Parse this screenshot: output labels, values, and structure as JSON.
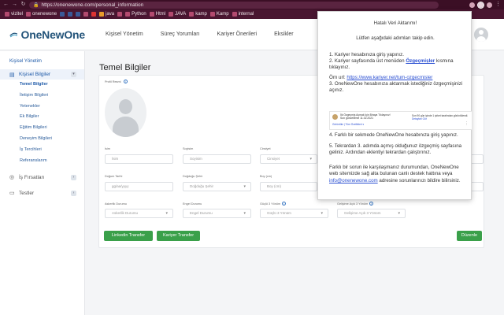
{
  "browser": {
    "url": "https://onenewone.com/personal_information",
    "bookmarks": [
      "vizitel",
      "onenewone",
      "",
      "",
      "",
      "",
      "",
      "java",
      "",
      "Python",
      "Html",
      "JAVA",
      "kamp",
      "Kamp",
      "internal"
    ]
  },
  "header": {
    "logo_text": "OneNewOne",
    "nav": [
      "Kişisel Yönetim",
      "Süreç Yorumları",
      "Kariyer Önerileri",
      "Eksikler"
    ]
  },
  "sidebar": {
    "section_title": "Kişisel Yönetim",
    "groups": [
      {
        "label": "Kişisel Bilgiler",
        "open": true
      },
      {
        "label": "İş Fırsatları",
        "open": false
      },
      {
        "label": "Testler",
        "open": false
      }
    ],
    "sub_items": [
      "Temel Bilgiler",
      "İletişim Bilgileri",
      "Yetenekler",
      "Ek Bilgiler",
      "Eğitim Bilgileri",
      "Deneyim Bilgileri",
      "İş Tercihleri",
      "Referanslarım"
    ]
  },
  "main": {
    "page_title": "Temel Bilgiler",
    "photo_label": "Profil Resmi",
    "fields": {
      "name_label": "İsim",
      "name_placeholder": "İsim",
      "surname_label": "Soyisim",
      "surname_placeholder": "Soyisim",
      "gender_label": "Cinsiyet",
      "gender_placeholder": "Cinsiyet",
      "birthdate_label": "Doğum Tarihi",
      "birthdate_placeholder": "gg/aa/yyyy",
      "birthplace_label": "Doğduğu Şehir",
      "birthplace_placeholder": "Doğduğu Şehir",
      "height_label": "Boy (cm)",
      "height_placeholder": "Boy (cm)",
      "military_label": "Askerlik Durumu",
      "military_placeholder": "Askerlik Durumu",
      "disability_label": "Engel Durumu",
      "disability_placeholder": "Engel Durumu",
      "strength3_label": "Güçlü 3 Yönüm",
      "strength3_placeholder": "Güçlü 3 Yönüm",
      "weakness3_label": "Gelişime Açık 3 Yönüm",
      "weakness3_placeholder": "Gelişime Açık 3 Yönüm"
    },
    "buttons": {
      "linkedin": "Linkedin Transfer",
      "kariyer": "Kariyer Transfer",
      "edit": "Düzenle"
    }
  },
  "popup": {
    "title": "Hatalı Veri Aktarımı!",
    "subtitle": "Lütfen aşağıdaki adımları takip edin.",
    "step1": "1. Kariyer hesabınıza giriş yapınız.",
    "step2_a": "2. Kariyer sayfasında üst menüden ",
    "step2_link": "Özgeçmişler",
    "step2_b": " kısmına tıklayınız.",
    "example_prefix": "Örn url: ",
    "example_url": "https://www.kariyer.net/tum-ozgecmisler",
    "step3": "3. OneNewOne hesabınıza aktarmak istediğiniz özgeçmişinizi açınız.",
    "step4": "4. Farklı bir sekmede OneNewOne hesabınıza giriş yapınız.",
    "step5": "5. Tekrardan 3. adımda açmış olduğunuz özgeçmiş sayfasına geliniz. Ardından eklentiyi tekrardan çalıştırınız.",
    "help_a": "Farklı bir sorun ile karşılaşmanız durumundan, OneNewOne web sitemizde sağ alta bulunan canlı destek hattına veya ",
    "help_email": "info@onenewone.com",
    "help_b": " adresine sorunlarınızı bildire bilirsiniz.",
    "thumb_title": "İlk Özgeçmiş Açmak İçin Biraya Tıklayınız!",
    "thumb_date": "Son güncelleme 11.02.2021",
    "thumb_links": "Görüntüle   |   Tüm Özellikleri ▾",
    "thumb_right_a": "Son 90 gün içinde 1 şirket tarafından görüntülendi. ",
    "thumb_right_link": "Detayları Gör"
  }
}
